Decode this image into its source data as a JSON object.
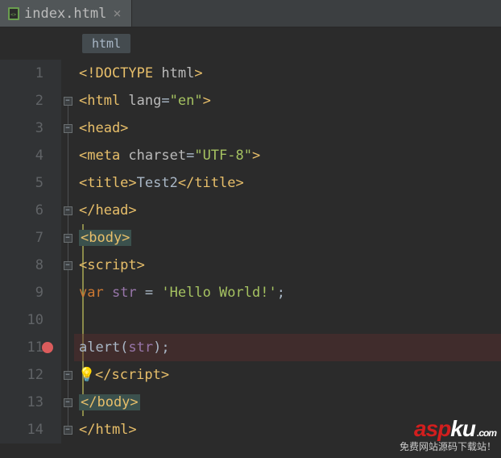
{
  "tab": {
    "filename": "index.html"
  },
  "breadcrumb": {
    "item": "html"
  },
  "gutter": {
    "lines": [
      "1",
      "2",
      "3",
      "4",
      "5",
      "6",
      "7",
      "8",
      "9",
      "10",
      "11",
      "12",
      "13",
      "14"
    ],
    "breakpoint_line": 11
  },
  "code": {
    "l1": {
      "a": "<!DOCTYPE ",
      "b": "html",
      "c": ">"
    },
    "l2": {
      "a": "<html ",
      "b": "lang",
      "c": "=",
      "d": "\"en\"",
      "e": ">"
    },
    "l3": {
      "a": "<head>"
    },
    "l4": {
      "a": "<meta ",
      "b": "charset",
      "c": "=",
      "d": "\"UTF-8\"",
      "e": ">"
    },
    "l5": {
      "a": "<title>",
      "b": "Test2",
      "c": "</title>"
    },
    "l6": {
      "a": "</head>"
    },
    "l7": {
      "a": "<body>"
    },
    "l8": {
      "a": "<script>"
    },
    "l9": {
      "a": "var ",
      "b": "str",
      "c": " = ",
      "d": "'Hello World!'",
      "e": ";"
    },
    "l11": {
      "a": "alert(",
      "b": "str",
      "c": ");"
    },
    "l12": {
      "a": "</script>"
    },
    "l13": {
      "a": "</body>"
    },
    "l14": {
      "a": "</html>"
    }
  },
  "watermark": {
    "brand_red": "asp",
    "brand_white": "ku",
    "tld": ".com",
    "subtitle": "免费网站源码下载站！"
  }
}
